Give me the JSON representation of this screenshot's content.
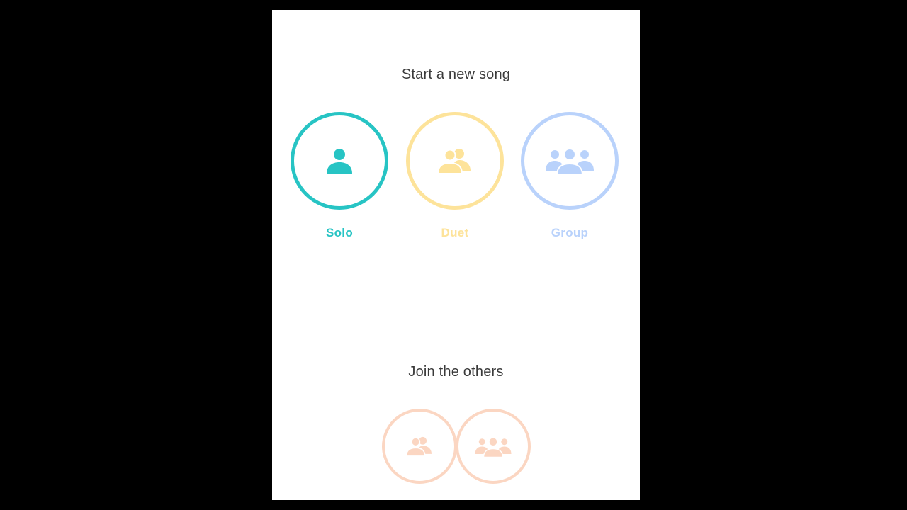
{
  "start_section": {
    "title": "Start a new song",
    "modes": [
      {
        "label": "Solo",
        "icon": "person-icon",
        "color": "#27c4c4"
      },
      {
        "label": "Duet",
        "icon": "two-people-icon",
        "color": "#fde39a"
      },
      {
        "label": "Group",
        "icon": "group-icon",
        "color": "#b9d2fb"
      }
    ]
  },
  "join_section": {
    "title": "Join the others",
    "options": [
      {
        "icon": "join-duet-icon",
        "color": "#fbd6c2"
      },
      {
        "icon": "join-group-icon",
        "color": "#fbd6c2"
      }
    ]
  }
}
